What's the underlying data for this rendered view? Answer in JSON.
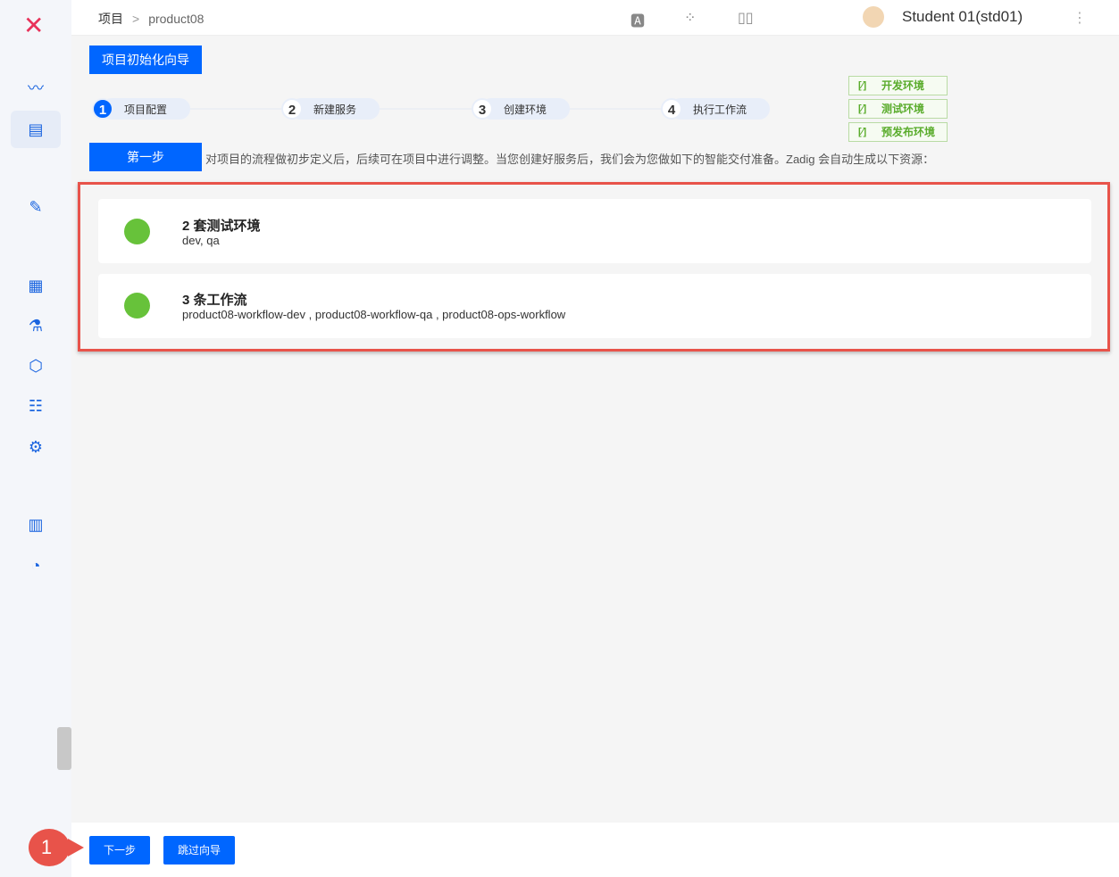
{
  "breadcrumb": {
    "root": "项目",
    "sep": ">",
    "project": "product08"
  },
  "user": {
    "name": "Student 01(std01)"
  },
  "wizard": {
    "title": "项目初始化向导",
    "steps": [
      {
        "num": "1",
        "label": "项目配置"
      },
      {
        "num": "2",
        "label": "新建服务"
      },
      {
        "num": "3",
        "label": "创建环境"
      },
      {
        "num": "4",
        "label": "执行工作流"
      }
    ],
    "env_tags": [
      "开发环境",
      "测试环境",
      "预发布环境"
    ],
    "step_label": "第一步",
    "description": "对项目的流程做初步定义后，后续可在项目中进行调整。当您创建好服务后，我们会为您做如下的智能交付准备。Zadig 会自动生成以下资源：",
    "resources": [
      {
        "title": "2 套测试环境",
        "detail": "dev, qa"
      },
      {
        "title": "3 条工作流",
        "detail": "product08-workflow-dev , product08-workflow-qa , product08-ops-workflow"
      }
    ]
  },
  "footer": {
    "next": "下一步",
    "skip": "跳过向导"
  },
  "annotation": {
    "badge": "1"
  },
  "colors": {
    "primary": "#0066ff",
    "success": "#67c23a",
    "highlight": "#e8534a"
  }
}
